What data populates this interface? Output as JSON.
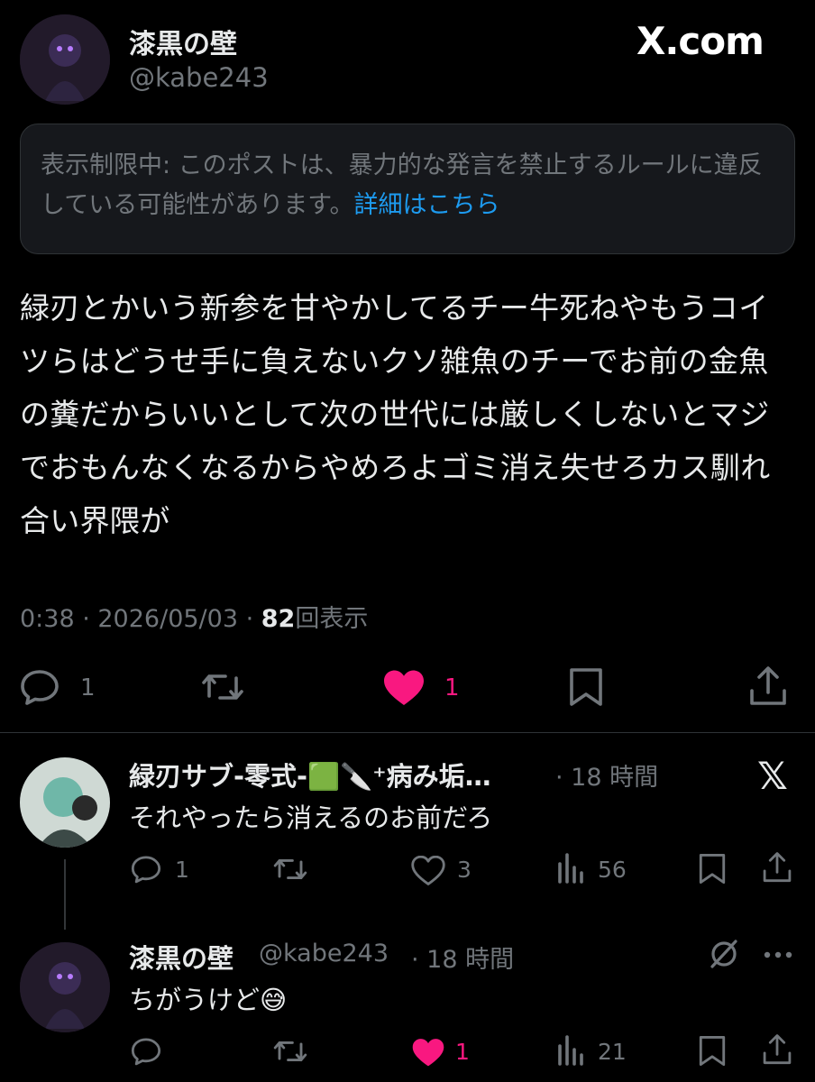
{
  "main_post": {
    "author_name": "漆黒の壁",
    "author_handle": "@kabe243",
    "brand": "X.com",
    "notice_text": "表示制限中: このポストは、暴力的な発言を禁止するルールに違反している可能性があります。",
    "notice_link": "詳細はこちら",
    "text": "緑刃とかいう新参を甘やかしてるチー牛死ねやもうコイツらはどうせ手に負えないクソ雑魚のチーでお前の金魚の糞だからいいとして次の世代には厳しくしないとマジでおもんなくなるからやめろよゴミ消え失せろカス馴れ合い界隈が",
    "time": "0:38 · 2026/05/03 · ",
    "views": "82",
    "views_label": "回表示",
    "actions": {
      "replies": "1",
      "likes": "1"
    }
  },
  "replies": [
    {
      "author_name": "緑刃サブ-零式-🟩🔪⁺病み垢…",
      "time": "· 18 時間",
      "text": "それやったら消えるのお前だろ",
      "stats": {
        "replies": "1",
        "reposts": "",
        "likes": "3",
        "views": "56"
      }
    },
    {
      "author_name": "漆黒の壁",
      "author_handle": "@kabe243",
      "time": "· 18 時間",
      "text": "ちがうけど😅",
      "stats": {
        "replies": "",
        "reposts": "",
        "likes": "1",
        "views": "21"
      }
    }
  ],
  "colors": {
    "background": "#000000",
    "text": "#e7e9ea",
    "muted": "#71767b",
    "link": "#1d9bf0",
    "like": "#f91880"
  }
}
